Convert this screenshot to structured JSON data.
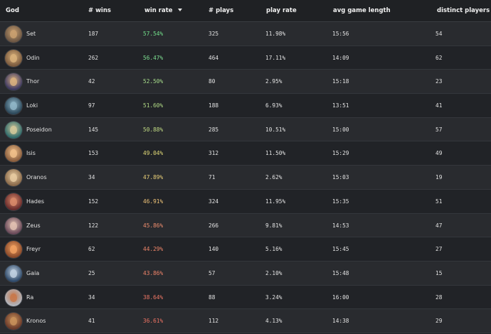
{
  "columns": {
    "god": "God",
    "wins": "# wins",
    "win_rate": "win rate",
    "plays": "# plays",
    "play_rate": "play rate",
    "avg_game_length": "avg game length",
    "distinct_players": "distinct players"
  },
  "sort_indicator": "chevron-down-icon",
  "colors": {
    "win_rate_high": "#74e28a",
    "win_rate_mid": "#e7e07a",
    "win_rate_low": "#f07a6a"
  },
  "rows": [
    {
      "god": "Set",
      "wins": "187",
      "win_rate": "57.54%",
      "plays": "325",
      "play_rate": "11.98%",
      "avg": "15:56",
      "players": "54",
      "rate_color": "#72e08a",
      "avatar_bg": "#6b5644",
      "avatar_glow": "#c9a070"
    },
    {
      "god": "Odin",
      "wins": "262",
      "win_rate": "56.47%",
      "plays": "464",
      "play_rate": "17.11%",
      "avg": "14:09",
      "players": "62",
      "rate_color": "#7ee092",
      "avatar_bg": "#7a5a3e",
      "avatar_glow": "#d8b07a"
    },
    {
      "god": "Thor",
      "wins": "42",
      "win_rate": "52.50%",
      "plays": "80",
      "play_rate": "2.95%",
      "avg": "15:18",
      "players": "23",
      "rate_color": "#a6dc8a",
      "avatar_bg": "#3f3a63",
      "avatar_glow": "#d9b07f"
    },
    {
      "god": "Loki",
      "wins": "97",
      "win_rate": "51.60%",
      "plays": "188",
      "play_rate": "6.93%",
      "avg": "13:51",
      "players": "41",
      "rate_color": "#b2dc86",
      "avatar_bg": "#2e4a5c",
      "avatar_glow": "#8fb5c7"
    },
    {
      "god": "Poseidon",
      "wins": "145",
      "win_rate": "50.88%",
      "plays": "285",
      "play_rate": "10.51%",
      "avg": "15:00",
      "players": "57",
      "rate_color": "#c2dc84",
      "avatar_bg": "#2f6a6a",
      "avatar_glow": "#d2c89a"
    },
    {
      "god": "Isis",
      "wins": "153",
      "win_rate": "49.04%",
      "plays": "312",
      "play_rate": "11.50%",
      "avg": "15:29",
      "players": "49",
      "rate_color": "#e4dc78",
      "avatar_bg": "#8a5e3e",
      "avatar_glow": "#f0c08a"
    },
    {
      "god": "Oranos",
      "wins": "34",
      "win_rate": "47.89%",
      "plays": "71",
      "play_rate": "2.62%",
      "avg": "15:03",
      "players": "19",
      "rate_color": "#ead078",
      "avatar_bg": "#8a6a4a",
      "avatar_glow": "#e6caa0"
    },
    {
      "god": "Hades",
      "wins": "152",
      "win_rate": "46.91%",
      "plays": "324",
      "play_rate": "11.95%",
      "avg": "15:35",
      "players": "51",
      "rate_color": "#f0c478",
      "avatar_bg": "#6a2c2c",
      "avatar_glow": "#d88a6a"
    },
    {
      "god": "Zeus",
      "wins": "122",
      "win_rate": "45.86%",
      "plays": "266",
      "play_rate": "9.81%",
      "avg": "14:53",
      "players": "47",
      "rate_color": "#f08e6e",
      "avatar_bg": "#6a4a5a",
      "avatar_glow": "#e0c0b0"
    },
    {
      "god": "Freyr",
      "wins": "62",
      "win_rate": "44.29%",
      "plays": "140",
      "play_rate": "5.16%",
      "avg": "15:45",
      "players": "27",
      "rate_color": "#f0866a",
      "avatar_bg": "#8a4a2a",
      "avatar_glow": "#f0a060"
    },
    {
      "god": "Gaia",
      "wins": "25",
      "win_rate": "43.86%",
      "plays": "57",
      "play_rate": "2.10%",
      "avg": "15:48",
      "players": "15",
      "rate_color": "#f0846a",
      "avatar_bg": "#2f4a6a",
      "avatar_glow": "#c0d0e0"
    },
    {
      "god": "Ra",
      "wins": "34",
      "win_rate": "38.64%",
      "plays": "88",
      "play_rate": "3.24%",
      "avg": "16:00",
      "players": "28",
      "rate_color": "#f07866",
      "avatar_bg": "#b0b4bc",
      "avatar_glow": "#c8784a"
    },
    {
      "god": "Kronos",
      "wins": "41",
      "win_rate": "36.61%",
      "plays": "112",
      "play_rate": "4.13%",
      "avg": "14:38",
      "players": "29",
      "rate_color": "#f07464",
      "avatar_bg": "#6a3a2a",
      "avatar_glow": "#c8905a"
    }
  ]
}
